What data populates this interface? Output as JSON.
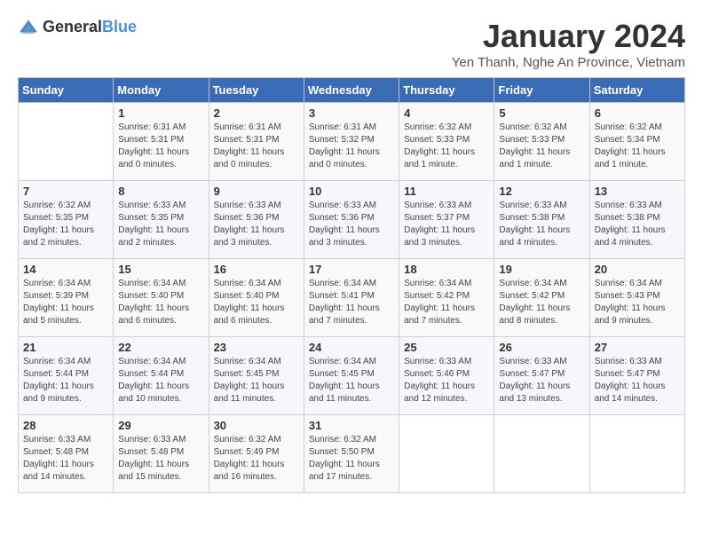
{
  "logo": {
    "general": "General",
    "blue": "Blue"
  },
  "header": {
    "title": "January 2024",
    "subtitle": "Yen Thanh, Nghe An Province, Vietnam"
  },
  "weekdays": [
    "Sunday",
    "Monday",
    "Tuesday",
    "Wednesday",
    "Thursday",
    "Friday",
    "Saturday"
  ],
  "weeks": [
    [
      {
        "day": "",
        "info": ""
      },
      {
        "day": "1",
        "info": "Sunrise: 6:31 AM\nSunset: 5:31 PM\nDaylight: 11 hours\nand 0 minutes."
      },
      {
        "day": "2",
        "info": "Sunrise: 6:31 AM\nSunset: 5:31 PM\nDaylight: 11 hours\nand 0 minutes."
      },
      {
        "day": "3",
        "info": "Sunrise: 6:31 AM\nSunset: 5:32 PM\nDaylight: 11 hours\nand 0 minutes."
      },
      {
        "day": "4",
        "info": "Sunrise: 6:32 AM\nSunset: 5:33 PM\nDaylight: 11 hours\nand 1 minute."
      },
      {
        "day": "5",
        "info": "Sunrise: 6:32 AM\nSunset: 5:33 PM\nDaylight: 11 hours\nand 1 minute."
      },
      {
        "day": "6",
        "info": "Sunrise: 6:32 AM\nSunset: 5:34 PM\nDaylight: 11 hours\nand 1 minute."
      }
    ],
    [
      {
        "day": "7",
        "info": "Sunrise: 6:32 AM\nSunset: 5:35 PM\nDaylight: 11 hours\nand 2 minutes."
      },
      {
        "day": "8",
        "info": "Sunrise: 6:33 AM\nSunset: 5:35 PM\nDaylight: 11 hours\nand 2 minutes."
      },
      {
        "day": "9",
        "info": "Sunrise: 6:33 AM\nSunset: 5:36 PM\nDaylight: 11 hours\nand 3 minutes."
      },
      {
        "day": "10",
        "info": "Sunrise: 6:33 AM\nSunset: 5:36 PM\nDaylight: 11 hours\nand 3 minutes."
      },
      {
        "day": "11",
        "info": "Sunrise: 6:33 AM\nSunset: 5:37 PM\nDaylight: 11 hours\nand 3 minutes."
      },
      {
        "day": "12",
        "info": "Sunrise: 6:33 AM\nSunset: 5:38 PM\nDaylight: 11 hours\nand 4 minutes."
      },
      {
        "day": "13",
        "info": "Sunrise: 6:33 AM\nSunset: 5:38 PM\nDaylight: 11 hours\nand 4 minutes."
      }
    ],
    [
      {
        "day": "14",
        "info": "Sunrise: 6:34 AM\nSunset: 5:39 PM\nDaylight: 11 hours\nand 5 minutes."
      },
      {
        "day": "15",
        "info": "Sunrise: 6:34 AM\nSunset: 5:40 PM\nDaylight: 11 hours\nand 6 minutes."
      },
      {
        "day": "16",
        "info": "Sunrise: 6:34 AM\nSunset: 5:40 PM\nDaylight: 11 hours\nand 6 minutes."
      },
      {
        "day": "17",
        "info": "Sunrise: 6:34 AM\nSunset: 5:41 PM\nDaylight: 11 hours\nand 7 minutes."
      },
      {
        "day": "18",
        "info": "Sunrise: 6:34 AM\nSunset: 5:42 PM\nDaylight: 11 hours\nand 7 minutes."
      },
      {
        "day": "19",
        "info": "Sunrise: 6:34 AM\nSunset: 5:42 PM\nDaylight: 11 hours\nand 8 minutes."
      },
      {
        "day": "20",
        "info": "Sunrise: 6:34 AM\nSunset: 5:43 PM\nDaylight: 11 hours\nand 9 minutes."
      }
    ],
    [
      {
        "day": "21",
        "info": "Sunrise: 6:34 AM\nSunset: 5:44 PM\nDaylight: 11 hours\nand 9 minutes."
      },
      {
        "day": "22",
        "info": "Sunrise: 6:34 AM\nSunset: 5:44 PM\nDaylight: 11 hours\nand 10 minutes."
      },
      {
        "day": "23",
        "info": "Sunrise: 6:34 AM\nSunset: 5:45 PM\nDaylight: 11 hours\nand 11 minutes."
      },
      {
        "day": "24",
        "info": "Sunrise: 6:34 AM\nSunset: 5:45 PM\nDaylight: 11 hours\nand 11 minutes."
      },
      {
        "day": "25",
        "info": "Sunrise: 6:33 AM\nSunset: 5:46 PM\nDaylight: 11 hours\nand 12 minutes."
      },
      {
        "day": "26",
        "info": "Sunrise: 6:33 AM\nSunset: 5:47 PM\nDaylight: 11 hours\nand 13 minutes."
      },
      {
        "day": "27",
        "info": "Sunrise: 6:33 AM\nSunset: 5:47 PM\nDaylight: 11 hours\nand 14 minutes."
      }
    ],
    [
      {
        "day": "28",
        "info": "Sunrise: 6:33 AM\nSunset: 5:48 PM\nDaylight: 11 hours\nand 14 minutes."
      },
      {
        "day": "29",
        "info": "Sunrise: 6:33 AM\nSunset: 5:48 PM\nDaylight: 11 hours\nand 15 minutes."
      },
      {
        "day": "30",
        "info": "Sunrise: 6:32 AM\nSunset: 5:49 PM\nDaylight: 11 hours\nand 16 minutes."
      },
      {
        "day": "31",
        "info": "Sunrise: 6:32 AM\nSunset: 5:50 PM\nDaylight: 11 hours\nand 17 minutes."
      },
      {
        "day": "",
        "info": ""
      },
      {
        "day": "",
        "info": ""
      },
      {
        "day": "",
        "info": ""
      }
    ]
  ]
}
